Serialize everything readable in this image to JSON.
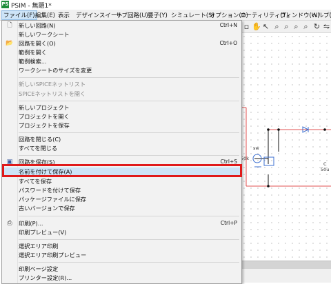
{
  "window": {
    "title": "PSIM - 無題1*",
    "app_icon": "psim-logo-icon"
  },
  "menubar": {
    "items": [
      {
        "label": "ファイル(F)"
      },
      {
        "label": "編集(E)"
      },
      {
        "label": "表示"
      },
      {
        "label": "デザインスイート"
      },
      {
        "label": "サブ回路(U)"
      },
      {
        "label": "要子(Y)"
      },
      {
        "label": "シミュレート(S)"
      },
      {
        "label": "オプション(O)"
      },
      {
        "label": "ユーティリティ(T)"
      },
      {
        "label": "ウィンドウ(W)"
      },
      {
        "label": "ヘルプ(H"
      }
    ]
  },
  "schematic": {
    "labels": {
      "sw": "sw",
      "r": "50k",
      "c_name": "C",
      "c_val": "50u"
    }
  },
  "file_menu": {
    "items": [
      {
        "label": "新しい回路(N)",
        "shortcut": "Ctrl+N",
        "icon": "new-file-icon"
      },
      {
        "label": "新しいワークシート",
        "shortcut": ""
      },
      {
        "label": "回路を開く(O)",
        "shortcut": "Ctrl+O",
        "icon": "open-folder-icon"
      },
      {
        "label": "範例を開く",
        "shortcut": ""
      },
      {
        "label": "範例検索...",
        "shortcut": ""
      },
      {
        "label": "ワークシートのサイズを変更",
        "shortcut": ""
      },
      {
        "label": "新しいSPICEネットリスト",
        "shortcut": "",
        "disabled": true
      },
      {
        "label": "SPICEネットリストを開く",
        "shortcut": "",
        "disabled": true
      },
      {
        "label": "新しいプロジェクト",
        "shortcut": ""
      },
      {
        "label": "プロジェクトを開く",
        "shortcut": ""
      },
      {
        "label": "プロジェクトを保存",
        "shortcut": ""
      },
      {
        "label": "回路を閉じる(C)",
        "shortcut": ""
      },
      {
        "label": "すべてを閉じる",
        "shortcut": ""
      },
      {
        "label": "回路を保存(S)",
        "shortcut": "Ctrl+S",
        "icon": "save-disk-icon"
      },
      {
        "label": "名前を付けて保存(A)",
        "shortcut": "",
        "highlighted": true
      },
      {
        "label": "すべてを保存",
        "shortcut": ""
      },
      {
        "label": "パスワードを付けて保存",
        "shortcut": ""
      },
      {
        "label": "パッケージファイルに保存",
        "shortcut": ""
      },
      {
        "label": "古いバージョンで保存",
        "shortcut": ""
      },
      {
        "label": "印刷(P)...",
        "shortcut": "Ctrl+P",
        "icon": "printer-icon"
      },
      {
        "label": "印刷プレビュー(V)",
        "shortcut": ""
      },
      {
        "label": "選択エリア印刷",
        "shortcut": ""
      },
      {
        "label": "選択エリア印刷プレビュー",
        "shortcut": ""
      },
      {
        "label": "印刷ページ設定",
        "shortcut": ""
      },
      {
        "label": "プリンター設定(R)...",
        "shortcut": ""
      }
    ]
  },
  "colors": {
    "highlight": "#cde4f7",
    "annotation_box": "#e01a1a",
    "wire": "#e05050",
    "component": "#3b6fd0"
  }
}
